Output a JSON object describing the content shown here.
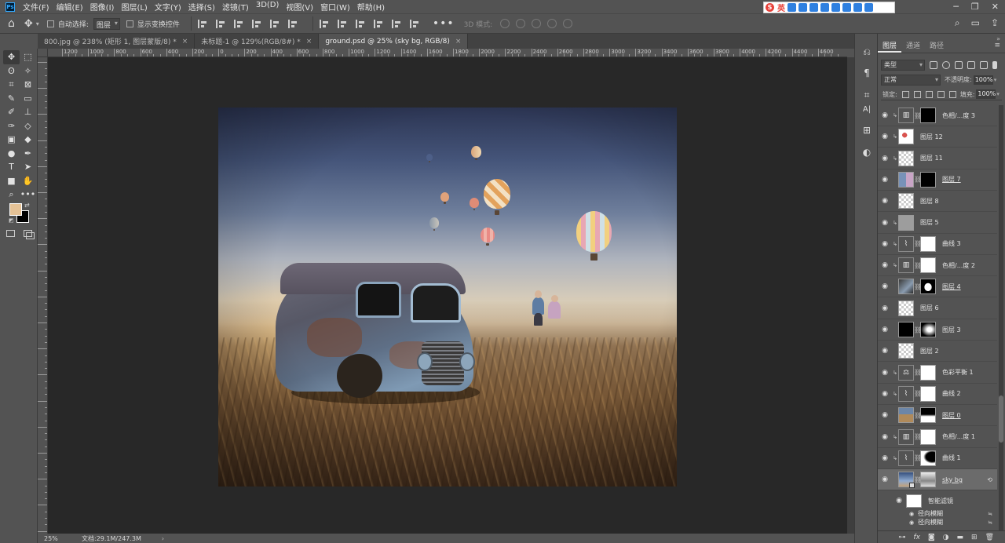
{
  "menubar": {
    "items": [
      "文件(F)",
      "编辑(E)",
      "图像(I)",
      "图层(L)",
      "文字(Y)",
      "选择(S)",
      "滤镜(T)",
      "3D(D)",
      "视图(V)",
      "窗口(W)",
      "帮助(H)"
    ],
    "ime_lang": "英"
  },
  "options": {
    "auto_select_label": "自动选择:",
    "auto_select_value": "图层",
    "show_transform_label": "显示变换控件",
    "mode_3d_label": "3D 模式:"
  },
  "tabs": [
    {
      "label": "800.jpg @ 238% (矩形 1, 图层蒙版/8) *",
      "active": false
    },
    {
      "label": "未标题-1 @ 129%(RGB/8#) *",
      "active": false
    },
    {
      "label": "ground.psd @ 25% (sky bg, RGB/8)",
      "active": true
    }
  ],
  "ruler": {
    "h_labels": [
      "1200",
      "1000",
      "800",
      "600",
      "400",
      "200",
      "0",
      "200",
      "400",
      "600",
      "800",
      "1000",
      "1200",
      "1400",
      "1600",
      "1800",
      "2000",
      "2200",
      "2400",
      "2600",
      "2800",
      "3000",
      "3200",
      "3400",
      "3600",
      "3800",
      "4000",
      "4200",
      "4400",
      "4600"
    ]
  },
  "status": {
    "zoom": "25%",
    "doc": "文档:29.1M/247.3M"
  },
  "colors": {
    "foreground": "#e5c296",
    "background": "#000000"
  },
  "layers_panel": {
    "tabs": [
      "图层",
      "通道",
      "路径"
    ],
    "kind_label": "类型",
    "blend_mode": "正常",
    "opacity_label": "不透明度:",
    "opacity_value": "100%",
    "lock_label": "锁定:",
    "fill_label": "填充:",
    "fill_value": "100%",
    "layers": [
      {
        "name": "色相/...度 3",
        "type": "adjustment",
        "icon": "hue-sat-icon",
        "mask": "black",
        "clipped": true
      },
      {
        "name": "图层 12",
        "type": "pixel",
        "thumb": "pixel-art",
        "clipped": true
      },
      {
        "name": "图层 11",
        "type": "pixel",
        "thumb": "checker",
        "clipped": true
      },
      {
        "name": "图层 7",
        "type": "pixel",
        "thumb": "kids",
        "mask": "black",
        "clipped": false,
        "underline": true
      },
      {
        "name": "图层 8",
        "type": "pixel",
        "thumb": "checker",
        "clipped": false
      },
      {
        "name": "图层 5",
        "type": "pixel",
        "thumb": "gray",
        "clipped": true
      },
      {
        "name": "曲线 3",
        "type": "adjustment",
        "icon": "curves-icon",
        "mask": "white",
        "clipped": true
      },
      {
        "name": "色相/...度 2",
        "type": "adjustment",
        "icon": "hue-sat-icon",
        "mask": "white",
        "clipped": true
      },
      {
        "name": "图层 4",
        "type": "pixel",
        "thumb": "van",
        "mask": "blob",
        "clipped": false,
        "underline": true
      },
      {
        "name": "图层 6",
        "type": "pixel",
        "thumb": "checker",
        "clipped": false
      },
      {
        "name": "图层 3",
        "type": "pixel",
        "thumb": "black",
        "mask": "radial",
        "clipped": false
      },
      {
        "name": "图层 2",
        "type": "pixel",
        "thumb": "checker",
        "clipped": false
      },
      {
        "name": "色彩平衡 1",
        "type": "adjustment",
        "icon": "balance-icon",
        "mask": "white",
        "clipped": true
      },
      {
        "name": "曲线 2",
        "type": "adjustment",
        "icon": "curves-icon",
        "mask": "white",
        "clipped": true
      },
      {
        "name": "图层 0",
        "type": "pixel",
        "thumb": "landscape",
        "mask": "gradient",
        "clipped": false,
        "underline": true
      },
      {
        "name": "色相/...度 1",
        "type": "adjustment",
        "icon": "hue-sat-icon",
        "mask": "white",
        "clipped": true
      },
      {
        "name": "曲线 1",
        "type": "adjustment",
        "icon": "curves-icon",
        "mask": "curve",
        "clipped": true
      },
      {
        "name": "sky bg",
        "type": "smart",
        "thumb": "sky",
        "mask": "fog",
        "clipped": false,
        "underline": true,
        "selected": true
      }
    ],
    "smart_filters_label": "智能滤镜",
    "filters": [
      "径向模糊",
      "径向模糊"
    ]
  }
}
